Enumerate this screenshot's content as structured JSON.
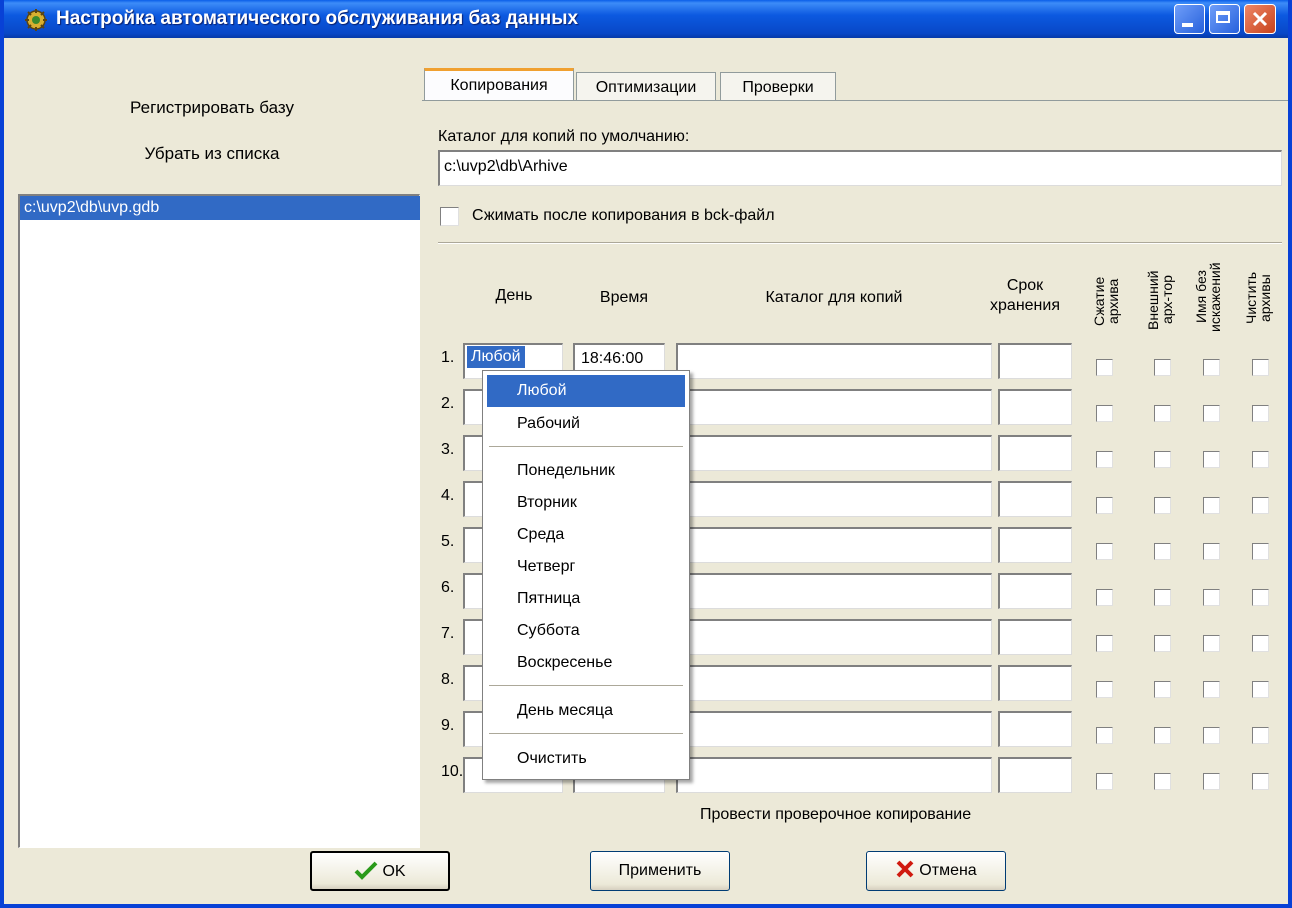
{
  "window": {
    "title": "Настройка автоматического обслуживания баз данных",
    "icon": "app-gear-icon",
    "controls": [
      "minimize-icon",
      "maximize-icon",
      "close-icon"
    ]
  },
  "left": {
    "register_label": "Регистрировать базу",
    "remove_label": "Убрать из списка",
    "databases": [
      "c:\\uvp2\\db\\uvp.gdb"
    ]
  },
  "tabs": [
    {
      "label": "Копирования",
      "active": true
    },
    {
      "label": "Оптимизации",
      "active": false
    },
    {
      "label": "Проверки",
      "active": false
    }
  ],
  "copy_tab": {
    "default_dir_label": "Каталог для копий по умолчанию:",
    "default_dir_value": "c:\\uvp2\\db\\Arhive",
    "compress_label": "Сжимать после копирования в bck-файл",
    "columns": {
      "day": "День",
      "time": "Время",
      "dir": "Каталог для копий",
      "retention": "Срок\nхранения",
      "compress": "Сжатие\nархива",
      "external": "Внешний\nарх-тор",
      "plainname": "Имя без\nискажений",
      "clean": "Чистить\nархивы"
    },
    "rows": [
      {
        "num": "1.",
        "day": "Любой",
        "time": "18:46:00"
      },
      {
        "num": "2."
      },
      {
        "num": "3."
      },
      {
        "num": "4."
      },
      {
        "num": "5."
      },
      {
        "num": "6."
      },
      {
        "num": "7."
      },
      {
        "num": "8."
      },
      {
        "num": "9."
      },
      {
        "num": "10."
      }
    ],
    "test_copy_label": "Провести проверочное копирование"
  },
  "day_menu": {
    "group1": [
      "Любой",
      "Рабочий"
    ],
    "group2": [
      "Понедельник",
      "Вторник",
      "Среда",
      "Четверг",
      "Пятница",
      "Суббота",
      "Воскресенье"
    ],
    "group3": [
      "День месяца"
    ],
    "group4": [
      "Очистить"
    ],
    "selected": "Любой"
  },
  "buttons": {
    "ok": "OK",
    "apply": "Применить",
    "cancel": "Отмена"
  },
  "colors": {
    "titlebar": "#0a5ee8",
    "selection": "#316ac5",
    "face": "#ece9d8"
  }
}
